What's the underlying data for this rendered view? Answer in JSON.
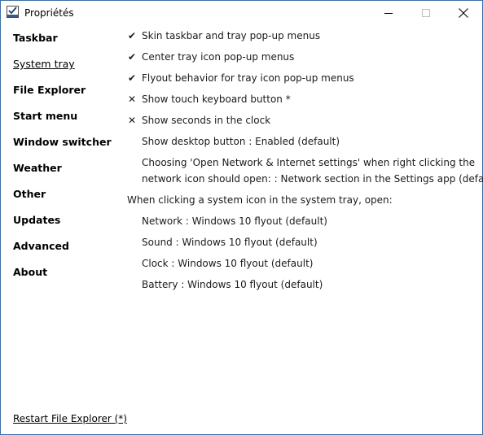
{
  "window": {
    "title": "Propriétés"
  },
  "sidebar": {
    "items": [
      {
        "label": "Taskbar"
      },
      {
        "label": "System tray"
      },
      {
        "label": "File Explorer"
      },
      {
        "label": "Start menu"
      },
      {
        "label": "Window switcher"
      },
      {
        "label": "Weather"
      },
      {
        "label": "Other"
      },
      {
        "label": "Updates"
      },
      {
        "label": "Advanced"
      },
      {
        "label": "About"
      }
    ],
    "selected": "System tray"
  },
  "options": {
    "skin_taskbar": {
      "mark": "✔",
      "label": "Skin taskbar and tray pop-up menus"
    },
    "center_tray": {
      "mark": "✔",
      "label": "Center tray icon pop-up menus"
    },
    "flyout_behavior": {
      "mark": "✔",
      "label": "Flyout behavior for tray icon pop-up menus"
    },
    "touch_keyboard": {
      "mark": "✕",
      "label": "Show touch keyboard button *"
    },
    "seconds_clock": {
      "mark": "✕",
      "label": "Show seconds in the clock"
    },
    "show_desktop": {
      "label": "Show desktop button : Enabled (default)"
    },
    "network_settings_line1": "Choosing 'Open Network & Internet settings' when right clicking the",
    "network_settings_line2": "network icon should open: : Network section in the Settings app (default)",
    "system_icon_heading": "When clicking a system icon in the system tray, open:",
    "network": {
      "label": "Network : Windows 10 flyout (default)"
    },
    "sound": {
      "label": "Sound : Windows 10 flyout (default)"
    },
    "clock": {
      "label": "Clock : Windows 10 flyout (default)"
    },
    "battery": {
      "label": "Battery : Windows 10 flyout (default)"
    }
  },
  "footer": {
    "restart_label": "Restart File Explorer (*)"
  },
  "colors": {
    "window_border": "#3a6ea5",
    "text": "#1a1a1a"
  }
}
